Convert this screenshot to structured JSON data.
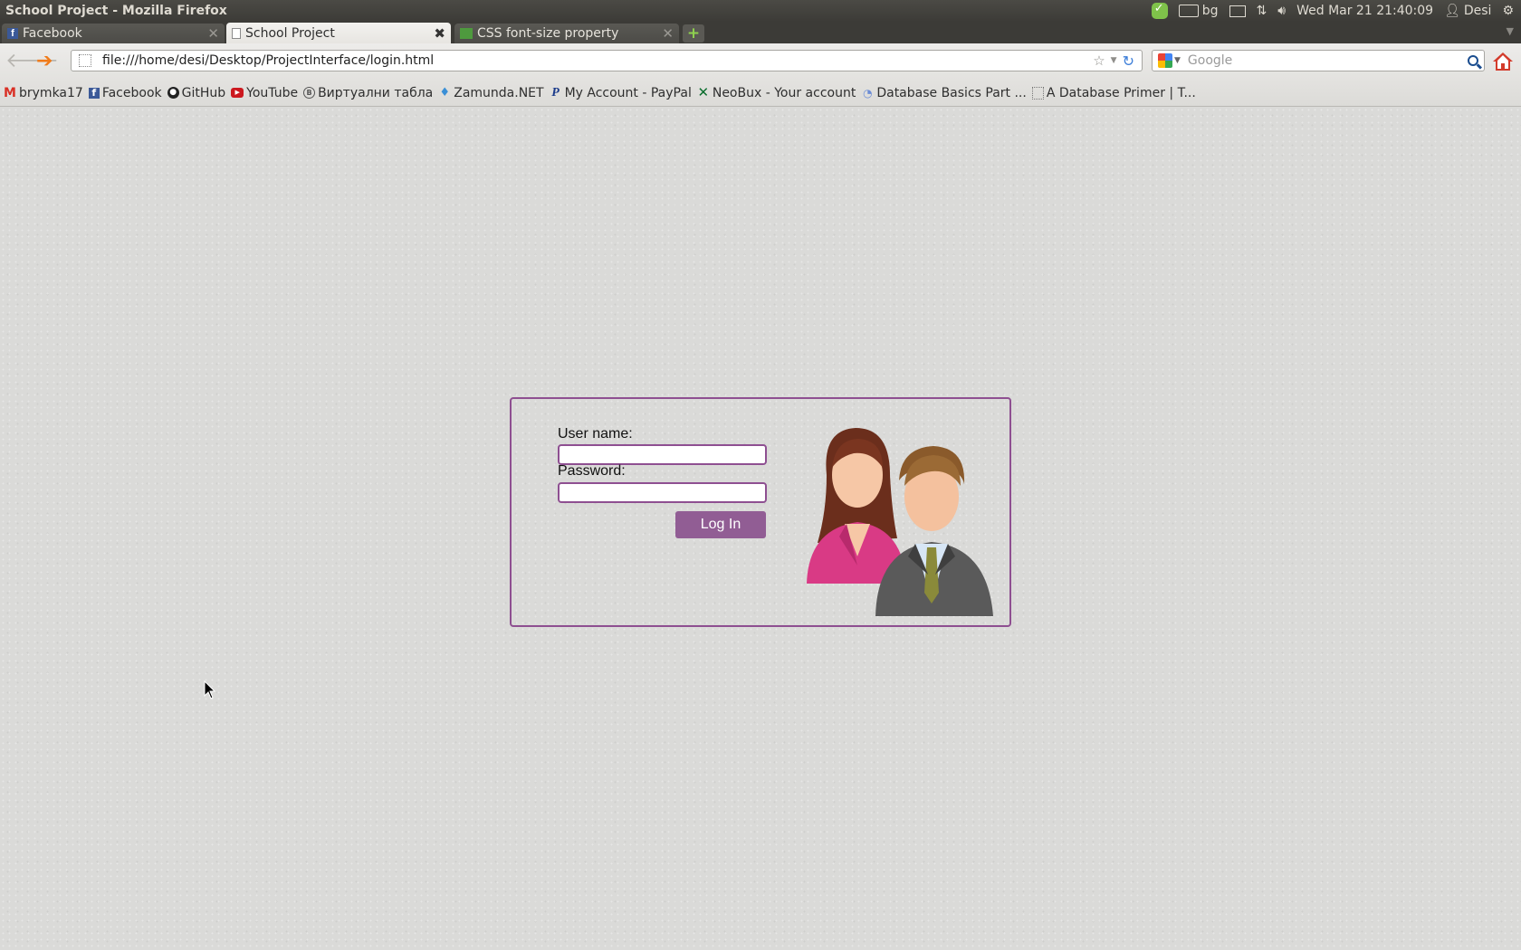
{
  "window": {
    "title": "School Project - Mozilla Firefox"
  },
  "system_tray": {
    "keyboard_layout": "bg",
    "datetime": "Wed Mar 21 21:40:09",
    "user": "Desi"
  },
  "tabs": [
    {
      "label": "Facebook",
      "icon": "facebook-icon",
      "active": false
    },
    {
      "label": "School Project",
      "icon": "blank-page-icon",
      "active": true
    },
    {
      "label": "CSS font-size property",
      "icon": "w3schools-icon",
      "active": false
    }
  ],
  "navigation": {
    "url": "file:///home/desi/Desktop/ProjectInterface/login.html",
    "search_placeholder": "Google"
  },
  "bookmarks": [
    {
      "label": "brymka17",
      "icon": "gmail-icon"
    },
    {
      "label": "Facebook",
      "icon": "facebook-icon"
    },
    {
      "label": "GitHub",
      "icon": "github-icon"
    },
    {
      "label": "YouTube",
      "icon": "youtube-icon"
    },
    {
      "label": "Виртуални табла",
      "icon": "vt-icon"
    },
    {
      "label": "Zamunda.NET",
      "icon": "zamunda-icon"
    },
    {
      "label": "My Account - PayPal",
      "icon": "paypal-icon"
    },
    {
      "label": "NeoBux - Your account",
      "icon": "neobux-icon"
    },
    {
      "label": "Database Basics Part ...",
      "icon": "database-icon"
    },
    {
      "label": "A Database Primer | T...",
      "icon": "blank-page-icon"
    }
  ],
  "login": {
    "username_label": "User name:",
    "username_value": "",
    "password_label": "Password:",
    "password_value": "",
    "submit_label": "Log In"
  },
  "colors": {
    "accent": "#8e4f91",
    "button": "#915d94",
    "page_background": "#dadad8"
  }
}
